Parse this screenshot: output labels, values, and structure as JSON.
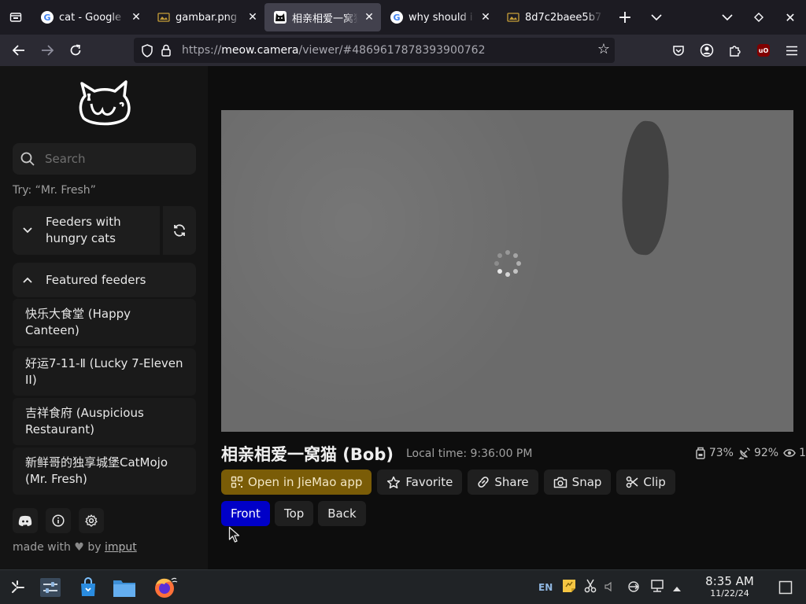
{
  "tabs": [
    {
      "title": "cat - Google Search",
      "favicon": "google-icon",
      "active": false
    },
    {
      "title": "gambar.png (PNG Image)",
      "favicon": "image-file-icon",
      "active": false
    },
    {
      "title": "相亲相爱一窝猫",
      "favicon": "meow-camera-icon",
      "active": true
    },
    {
      "title": "why should i feed cats",
      "favicon": "google-icon",
      "active": false
    },
    {
      "title": "8d7c2baee5b7",
      "favicon": "image-file-icon",
      "active": false
    }
  ],
  "urlbar": {
    "prefix": "https://",
    "host": "meow.camera",
    "path": "/viewer/#4869617878393900762"
  },
  "sidebar": {
    "search_placeholder": "Search",
    "try_hint": "Try: “Mr. Fresh”",
    "feeders_hungry_label": "Feeders with hungry cats",
    "featured_label": "Featured feeders",
    "featured_items": [
      {
        "name": "快乐大食堂 (Happy Canteen)"
      },
      {
        "name": "好运7-11-Ⅱ (Lucky 7-Eleven II)"
      },
      {
        "name": "吉祥食府 (Auspicious Restaurant)"
      },
      {
        "name": "新鲜哥的独享城堡CatMojo (Mr. Fresh)"
      }
    ],
    "made_with_prefix": "made with",
    "made_with_by": "by",
    "made_with_author": "imput"
  },
  "camera": {
    "title": "相亲相爱一窝猫 (Bob)",
    "local_time": "Local time: 9:36:00 PM",
    "food_level": "73%",
    "signal_level": "92%",
    "viewers": "1"
  },
  "actions": {
    "open_app": "Open in JieMao app",
    "favorite": "Favorite",
    "share": "Share",
    "snap": "Snap",
    "clip": "Clip"
  },
  "views": {
    "front": "Front",
    "top": "Top",
    "back": "Back",
    "selected": "Front"
  },
  "taskbar": {
    "lang": "EN",
    "time": "8:35 AM",
    "date": "11/22/24"
  },
  "colors": {
    "accent_open_app": "#7a5c07",
    "selected_view": "#0000c8"
  }
}
